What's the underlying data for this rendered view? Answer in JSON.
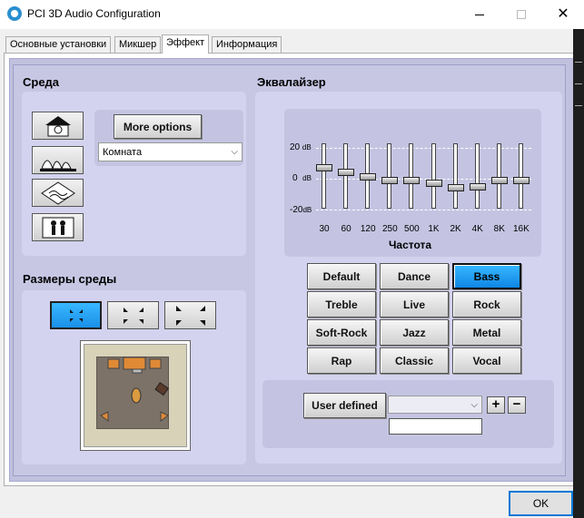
{
  "window": {
    "title": "PCI 3D Audio Configuration"
  },
  "tabs": [
    {
      "label": "Основные установки",
      "active": false
    },
    {
      "label": "Микшер",
      "active": false
    },
    {
      "label": "Эффект",
      "active": true
    },
    {
      "label": "Информация",
      "active": false
    }
  ],
  "environment": {
    "title": "Среда",
    "icons": [
      "house-icon",
      "opera-house-icon",
      "underwater-icon",
      "room-people-icon"
    ],
    "more_options_label": "More options",
    "preset_select": "Комната"
  },
  "room_size": {
    "title": "Размеры среды",
    "sizes": [
      "small-room-icon",
      "medium-room-icon",
      "large-room-icon"
    ],
    "selected_index": 0
  },
  "equalizer": {
    "title": "Эквалайзер",
    "db_labels": {
      "top": "20",
      "mid": "0",
      "bottom": "-20",
      "unit": "dB"
    },
    "frequencies": [
      "30",
      "60",
      "120",
      "250",
      "500",
      "1K",
      "2K",
      "4K",
      "8K",
      "16K"
    ],
    "levels_db": [
      7,
      4,
      1,
      -1,
      -1,
      -3,
      -6,
      -5,
      -1,
      -1
    ],
    "axis_label": "Частота",
    "presets": [
      [
        "Default",
        "Dance",
        "Bass"
      ],
      [
        "Treble",
        "Live",
        "Rock"
      ],
      [
        "Soft-Rock",
        "Jazz",
        "Metal"
      ],
      [
        "Rap",
        "Classic",
        "Vocal"
      ]
    ],
    "active_preset": "Bass",
    "user_defined_label": "User defined",
    "user_select_value": "",
    "user_name_value": "",
    "plus_label": "+",
    "minus_label": "−"
  },
  "footer": {
    "ok_label": "OK"
  }
}
